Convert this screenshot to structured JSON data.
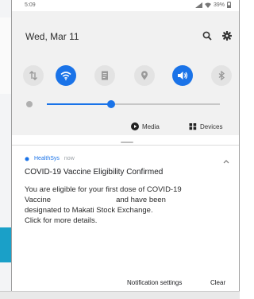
{
  "status_bar": {
    "time": "5:09",
    "battery": "39%"
  },
  "quick_settings": {
    "date": "Wed, Mar 11",
    "tiles": [
      {
        "icon": "data-transfer-icon",
        "state": "off"
      },
      {
        "icon": "wifi-icon",
        "state": "on"
      },
      {
        "icon": "document-icon",
        "state": "off"
      },
      {
        "icon": "location-icon",
        "state": "off"
      },
      {
        "icon": "sound-icon",
        "state": "on"
      },
      {
        "icon": "bluetooth-icon",
        "state": "off"
      }
    ],
    "brightness_level": 0.37,
    "media_label": "Media",
    "devices_label": "Devices"
  },
  "notification": {
    "app_name": "HealthSys",
    "time": "now",
    "title": "COVID-19 Vaccine Eligibility Confirmed",
    "body_lines": [
      "You are eligible for your first dose of COVID-19",
      "Vaccine",
      "and have been",
      "designated to Makati Stock Exchange.",
      "Click for more details."
    ]
  },
  "footer": {
    "settings_label": "Notification settings",
    "clear_label": "Clear"
  },
  "colors": {
    "accent": "#1a73e8",
    "panel": "#f1f1f1",
    "sidebar_accent": "#1aa0c8"
  }
}
